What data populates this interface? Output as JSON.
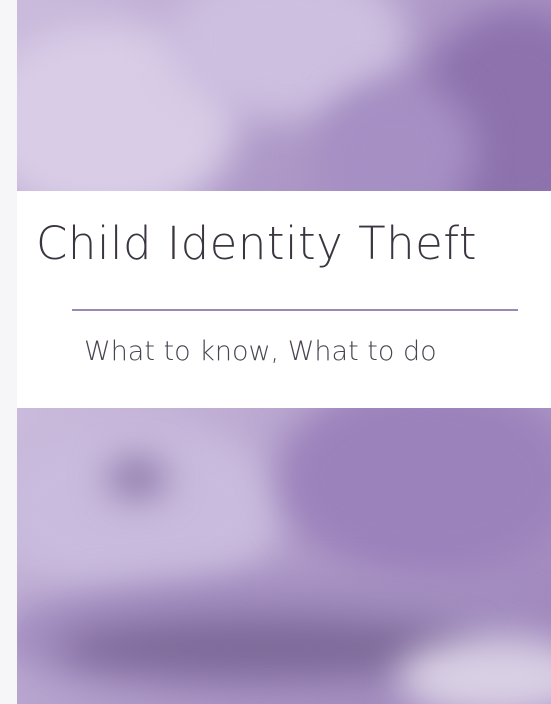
{
  "cover": {
    "title": "Child Identity Theft",
    "subtitle": "What to know, What to do"
  },
  "colors": {
    "photo_tint": "#b4a0cc",
    "rule": "#9a88b5",
    "text": "#3b3540"
  }
}
